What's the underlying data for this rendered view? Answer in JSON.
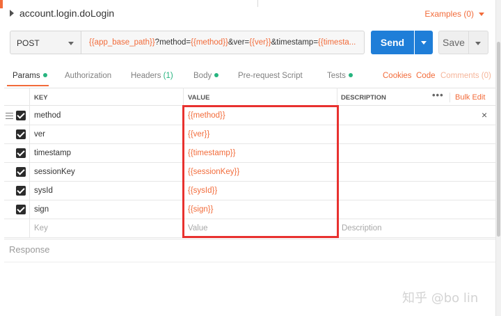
{
  "request": {
    "title": "account.login.doLogin",
    "examples_label": "Examples (0)",
    "method": "POST",
    "url_parts": [
      {
        "text": "{{app_base_path}}",
        "var": true
      },
      {
        "text": "?method=",
        "var": false
      },
      {
        "text": "{{method}}",
        "var": true
      },
      {
        "text": "&ver=",
        "var": false
      },
      {
        "text": "{{ver}}",
        "var": true
      },
      {
        "text": "&timestamp=",
        "var": false
      },
      {
        "text": "{{timesta...",
        "var": true
      }
    ],
    "send_label": "Send",
    "save_label": "Save"
  },
  "tabs": {
    "params": "Params",
    "authorization": "Authorization",
    "headers": "Headers",
    "headers_count": "(1)",
    "body": "Body",
    "prerequest": "Pre-request Script",
    "tests": "Tests",
    "cookies": "Cookies",
    "code": "Code",
    "comments": "Comments (0)"
  },
  "table": {
    "headers": {
      "key": "KEY",
      "value": "VALUE",
      "description": "DESCRIPTION",
      "more": "•••",
      "bulk_edit": "Bulk Edit"
    },
    "rows": [
      {
        "key": "method",
        "value": "{{method}}",
        "checked": true
      },
      {
        "key": "ver",
        "value": "{{ver}}",
        "checked": true
      },
      {
        "key": "timestamp",
        "value": "{{timestamp}}",
        "checked": true
      },
      {
        "key": "sessionKey",
        "value": "{{sessionKey}}",
        "checked": true
      },
      {
        "key": "sysId",
        "value": "{{sysId}}",
        "checked": true
      },
      {
        "key": "sign",
        "value": "{{sign}}",
        "checked": true
      }
    ],
    "placeholder": {
      "key": "Key",
      "value": "Value",
      "description": "Description"
    },
    "delete_glyph": "×"
  },
  "response_label": "Response",
  "watermark": "知乎 @bo lin",
  "colors": {
    "accent": "#f26b3a",
    "send_button": "#1f7ed8",
    "status_dot": "#26b47f",
    "highlight_box": "#e8312f"
  }
}
